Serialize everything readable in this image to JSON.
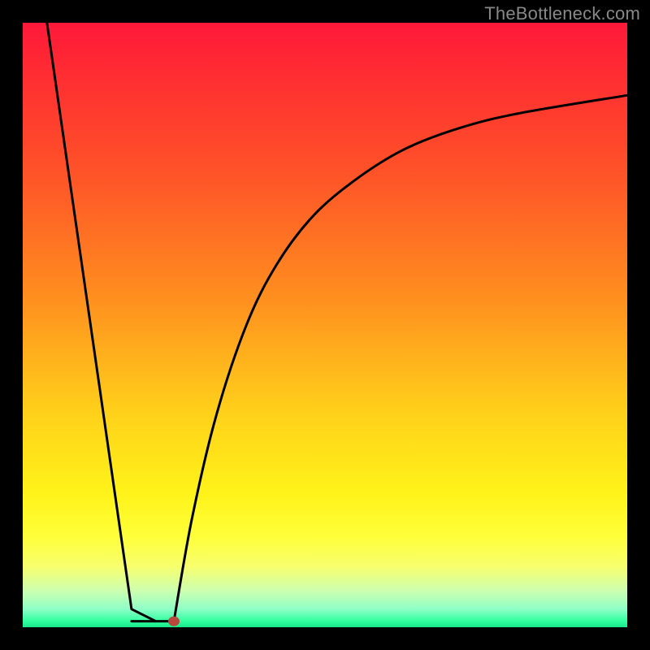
{
  "watermark": "TheBottleneck.com",
  "chart_data": {
    "type": "line",
    "title": "",
    "xlabel": "",
    "ylabel": "",
    "xlim": [
      0,
      100
    ],
    "ylim": [
      0,
      100
    ],
    "series": [
      {
        "name": "left-segment",
        "x": [
          4,
          18,
          22
        ],
        "y": [
          100,
          3,
          1
        ]
      },
      {
        "name": "flat-bottom",
        "x": [
          18,
          25
        ],
        "y": [
          1,
          1
        ]
      },
      {
        "name": "right-segment",
        "x": [
          25,
          28,
          32,
          37,
          42,
          48,
          55,
          63,
          72,
          82,
          100
        ],
        "y": [
          1,
          18,
          35,
          50,
          60,
          68,
          74,
          79,
          82.5,
          85,
          88
        ]
      }
    ],
    "marker": {
      "name": "bottom-dot",
      "x": 25,
      "y": 1,
      "color": "#b8473c"
    },
    "gradient_stops": [
      {
        "pos": 0,
        "color": "#ff183a"
      },
      {
        "pos": 25,
        "color": "#ff5328"
      },
      {
        "pos": 45,
        "color": "#ff8d1f"
      },
      {
        "pos": 65,
        "color": "#ffd21a"
      },
      {
        "pos": 85,
        "color": "#ffff3a"
      },
      {
        "pos": 97,
        "color": "#8effc6"
      },
      {
        "pos": 100,
        "color": "#18e88b"
      }
    ]
  }
}
